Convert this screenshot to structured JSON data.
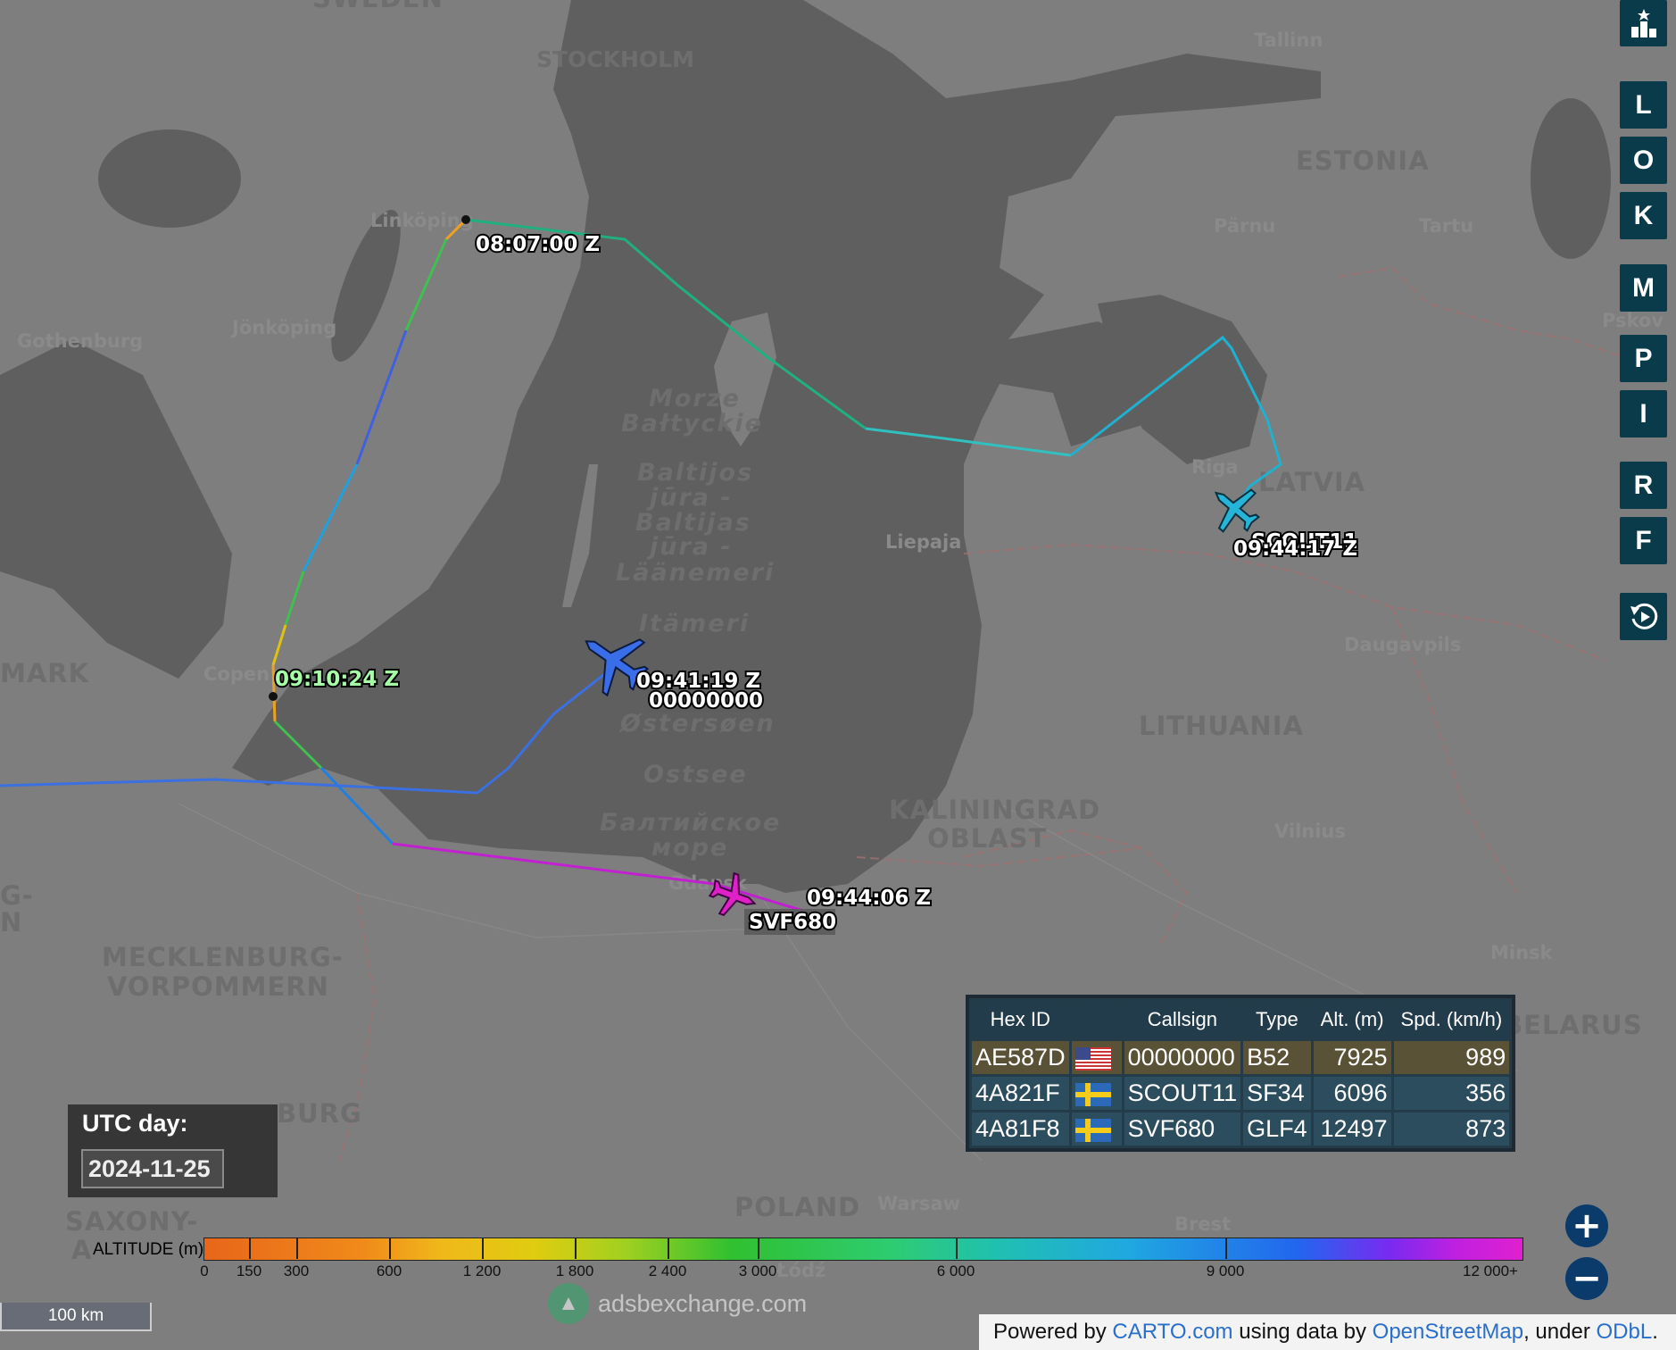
{
  "map": {
    "countries": [
      "ESTONIA",
      "LATVIA",
      "LITHUANIA",
      "BELARUS",
      "POLAND",
      "KALININGRAD",
      "OBLAST",
      "MECKLENBURG-",
      "VORPOMMERN",
      "SWEDEN",
      "MARK",
      "G-",
      "N",
      "SAXONY-",
      "A",
      "BURG"
    ],
    "cities": [
      "STOCKHOLM",
      "Tallinn",
      "Linköping",
      "Pärnu",
      "Tartu",
      "Pskov",
      "Jönköping",
      "Gothenburg",
      "Riga",
      "Liepaja",
      "Daugavpils",
      "Copen",
      "Vilnius",
      "Gdansk",
      "Minsk",
      "Warsaw",
      "Brest",
      "Łódź"
    ],
    "seas": [
      "Morze",
      "Bałtyckie",
      "Baltijos",
      "jūra -",
      "Baltijas",
      "jūra -",
      "Läänemeri",
      "Itämeri",
      "Østersøen",
      "Ostsee",
      "Балтийское",
      "море"
    ]
  },
  "aircraft": [
    {
      "time_label": "09:41:19 Z",
      "callsign_label": "00000000",
      "color": "#3a6ee8"
    },
    {
      "time_label": "09:44:17 Z",
      "callsign_label": "SCOUT11",
      "color": "#25b5d8"
    },
    {
      "time_label": "09:44:06 Z",
      "callsign_label": "SVF680",
      "color": "#e021c8"
    }
  ],
  "track_labels": {
    "t1": "08:07:00 Z",
    "t2": "09:10:24 Z"
  },
  "toolbar": {
    "buttons": [
      "L",
      "O",
      "K",
      "M",
      "P",
      "I",
      "R",
      "F"
    ],
    "top_icon": "ranking-icon",
    "replay_icon": "replay-icon"
  },
  "table": {
    "headers": [
      "Hex ID",
      "",
      "Callsign",
      "Type",
      "Alt. (m)",
      "Spd. (km/h)"
    ],
    "rows": [
      {
        "hex": "AE587D",
        "flag": "us-flag-icon",
        "callsign": "00000000",
        "type": "B52",
        "alt": "7925",
        "spd": "989"
      },
      {
        "hex": "4A821F",
        "flag": "se-flag-icon",
        "callsign": "SCOUT11",
        "type": "SF34",
        "alt": "6096",
        "spd": "356"
      },
      {
        "hex": "4A81F8",
        "flag": "se-flag-icon",
        "callsign": "SVF680",
        "type": "GLF4",
        "alt": "12497",
        "spd": "873"
      }
    ]
  },
  "utc": {
    "label": "UTC day:",
    "value": "2024-11-25"
  },
  "legend": {
    "title": "ALTITUDE (m)",
    "ticks": [
      "0",
      "150",
      "300",
      "600",
      "1 200",
      "1 800",
      "2 400",
      "3 000",
      "6 000",
      "9 000",
      "12 000+"
    ]
  },
  "scale": "100 km",
  "watermark": "adsbexchange.com",
  "attribution": {
    "prefix": "Powered by ",
    "carto": "CARTO.com",
    "mid": " using data by ",
    "osm": "OpenStreetMap",
    "sep": ", under ",
    "odbl": "ODbL",
    "end": "."
  },
  "zoom": {
    "in": "+",
    "out": "−"
  }
}
